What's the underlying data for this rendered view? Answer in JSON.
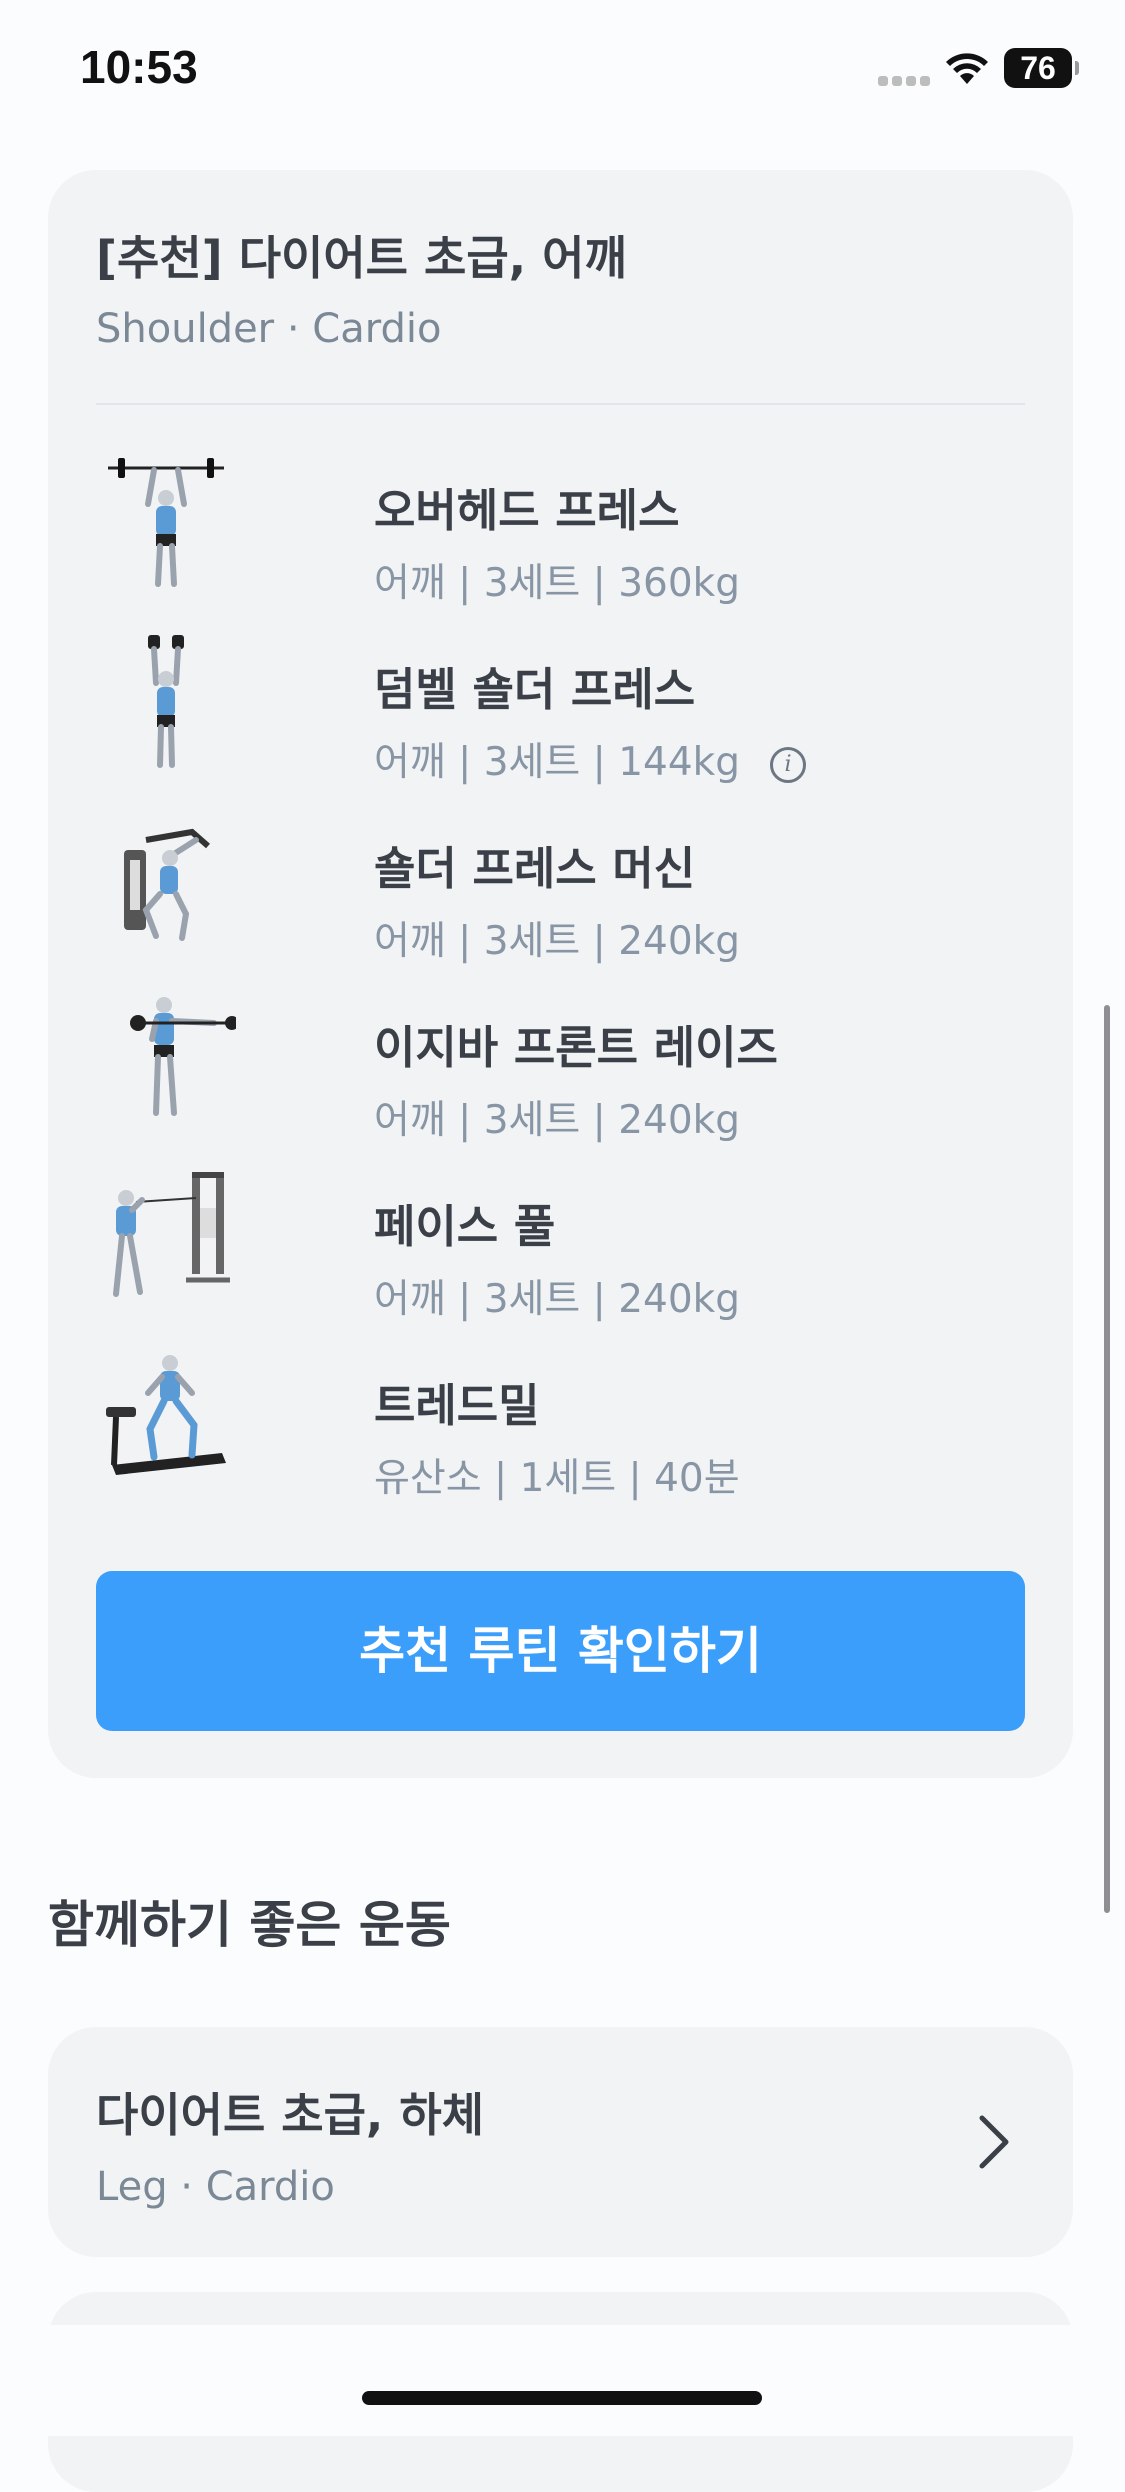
{
  "status_bar": {
    "time": "10:53",
    "battery": "76"
  },
  "recommended": {
    "title": "[추천] 다이어트 초급, 어깨",
    "subtitle": "Shoulder · Cardio",
    "exercises": [
      {
        "name": "오버헤드 프레스",
        "meta": "어깨 | 3세트 | 360kg",
        "icon": "overhead-press-illustration"
      },
      {
        "name": "덤벨 숄더 프레스",
        "meta": "어깨 | 3세트 | 144kg",
        "icon": "dumbbell-shoulder-press-illustration",
        "info": "i"
      },
      {
        "name": "숄더 프레스 머신",
        "meta": "어깨 | 3세트 | 240kg",
        "icon": "shoulder-press-machine-illustration"
      },
      {
        "name": "이지바 프론트 레이즈",
        "meta": "어깨 | 3세트 | 240kg",
        "icon": "ez-bar-front-raise-illustration"
      },
      {
        "name": "페이스 풀",
        "meta": "어깨 | 3세트 | 240kg",
        "icon": "face-pull-illustration"
      },
      {
        "name": "트레드밀",
        "meta": "유산소 | 1세트 | 40분",
        "icon": "treadmill-illustration"
      }
    ],
    "cta_label": "추천 루틴 확인하기"
  },
  "together": {
    "section_title": "함께하기 좋은 운동",
    "items": [
      {
        "title": "다이어트 초급, 하체",
        "subtitle": "Leg · Cardio"
      }
    ]
  },
  "colors": {
    "accent": "#3a9efa",
    "card_bg": "#f1f3f5",
    "muscle_highlight": "#5b9bd5"
  }
}
